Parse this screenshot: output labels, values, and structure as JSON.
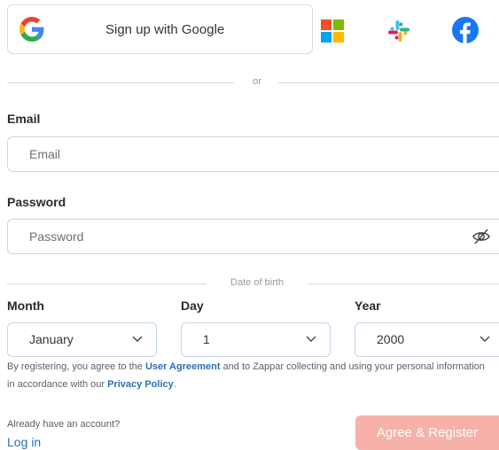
{
  "social": {
    "google_label": "Sign up with Google",
    "icons": [
      "google-icon",
      "microsoft-icon",
      "slack-icon",
      "facebook-icon"
    ]
  },
  "divider_or": "or",
  "email": {
    "label": "Email",
    "placeholder": "Email",
    "value": ""
  },
  "password": {
    "label": "Password",
    "placeholder": "Password",
    "value": ""
  },
  "dob": {
    "divider": "Date of birth",
    "month_label": "Month",
    "month_value": "January",
    "day_label": "Day",
    "day_value": "1",
    "year_label": "Year",
    "year_value": "2000"
  },
  "legal": {
    "part1": "By registering, you agree to the ",
    "user_agreement": "User Agreement",
    "part2": " and to Zappar collecting and using your personal information in accordance with our ",
    "privacy_policy": "Privacy Policy",
    "part3": "."
  },
  "footer": {
    "already": "Already have an account?",
    "login": "Log in",
    "register": "Agree & Register"
  },
  "colors": {
    "link": "#2c6fb7",
    "register_bg": "#f6b1a8",
    "input_border": "#c7d6ea"
  }
}
